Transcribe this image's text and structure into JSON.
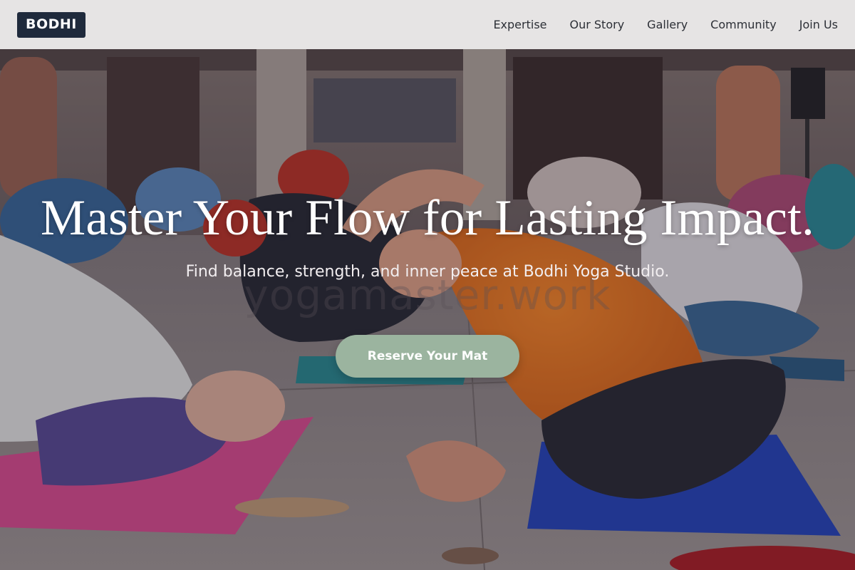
{
  "brand": {
    "logo": "BODHI"
  },
  "nav": [
    {
      "label": "Expertise"
    },
    {
      "label": "Our Story"
    },
    {
      "label": "Gallery"
    },
    {
      "label": "Community"
    },
    {
      "label": "Join Us"
    }
  ],
  "hero": {
    "title": "Master Your Flow for Lasting Impact.",
    "subtitle": "Find balance, strength, and inner peace at Bodhi Yoga Studio.",
    "watermark": "yogamaster.work",
    "cta_label": "Reserve Your Mat"
  },
  "colors": {
    "logo_bg": "#1f2a3c",
    "cta_bg": "#9bb49f",
    "header_bg": "#eeecec"
  }
}
